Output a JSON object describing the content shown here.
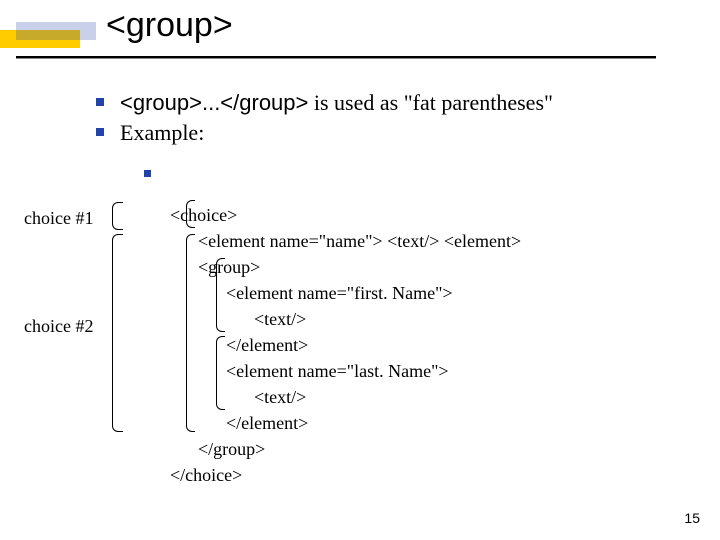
{
  "title": "<group>",
  "bullets": {
    "b1_mono": "<group>...</group>",
    "b1_rest": " is used as \"fat parentheses\"",
    "b2": "Example:"
  },
  "labels": {
    "c1": "choice #1",
    "c2": "choice #2"
  },
  "code": {
    "l0": "<choice>",
    "l1": "<element name=\"name\"> <text/> <element>",
    "l2": "<group>",
    "l3": "<element name=\"first. Name\">",
    "l4": "<text/>",
    "l5": "</element>",
    "l6": "<element name=\"last. Name\">",
    "l7": "<text/>",
    "l8": "</element>",
    "l9": "</group>",
    "l10": "</choice>"
  },
  "page": "15"
}
